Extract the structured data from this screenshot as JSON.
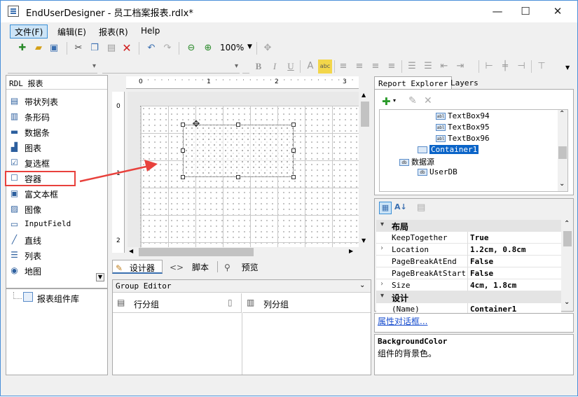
{
  "window": {
    "title": "EndUserDesigner - 员工档案报表.rdlx*",
    "minimize": "—",
    "maximize": "☐",
    "close": "✕"
  },
  "menu": {
    "items": [
      "文件(F)",
      "编辑(E)",
      "报表(R)",
      "Help"
    ]
  },
  "toolbar": {
    "zoom": "100%"
  },
  "toolbox": {
    "header": "RDL 报表",
    "items": [
      {
        "label": "带状列表",
        "icon": "banded-list-icon"
      },
      {
        "label": "条形码",
        "icon": "barcode-icon"
      },
      {
        "label": "数据条",
        "icon": "databar-icon"
      },
      {
        "label": "图表",
        "icon": "chart-icon"
      },
      {
        "label": "复选框",
        "icon": "checkbox-icon"
      },
      {
        "label": "容器",
        "icon": "container-icon"
      },
      {
        "label": "富文本框",
        "icon": "richtext-icon"
      },
      {
        "label": "图像",
        "icon": "image-icon"
      },
      {
        "label": "InputField",
        "icon": "inputfield-icon"
      },
      {
        "label": "直线",
        "icon": "line-icon"
      },
      {
        "label": "列表",
        "icon": "list-icon"
      },
      {
        "label": "地图",
        "icon": "map-icon"
      }
    ],
    "library": "报表组件库"
  },
  "ruler": {
    "marks": [
      "0",
      "1",
      "2",
      "3"
    ],
    "vmarks": [
      "0",
      "1",
      "2"
    ]
  },
  "design_tabs": {
    "designer": "设计器",
    "script": "脚本",
    "preview": "预览"
  },
  "group_editor": {
    "title": "Group Editor",
    "row_groups": "行分组",
    "column_groups": "列分组"
  },
  "right_tabs": {
    "explorer": "Report Explorer",
    "layers": "Layers"
  },
  "explorer_tree": [
    {
      "label": "TextBox94",
      "depth": 3,
      "icon": "textbox-icon",
      "tag": "abl"
    },
    {
      "label": "TextBox95",
      "depth": 3,
      "icon": "textbox-icon",
      "tag": "abl"
    },
    {
      "label": "TextBox96",
      "depth": 3,
      "icon": "textbox-icon",
      "tag": "abl"
    },
    {
      "label": "Container1",
      "depth": 2,
      "icon": "container-icon",
      "tag": "",
      "selected": true
    },
    {
      "label": "数据源",
      "depth": 1,
      "icon": "datasource-icon",
      "tag": "db"
    },
    {
      "label": "UserDB",
      "depth": 2,
      "icon": "dataset-icon",
      "tag": "db"
    }
  ],
  "properties": {
    "categories": [
      {
        "name": "布局",
        "rows": [
          {
            "name": "KeepTogether",
            "value": "True",
            "expandable": false
          },
          {
            "name": "Location",
            "value": "1.2cm, 0.8cm",
            "expandable": true
          },
          {
            "name": "PageBreakAtEnd",
            "value": "False",
            "expandable": false
          },
          {
            "name": "PageBreakAtStart",
            "value": "False",
            "expandable": false
          },
          {
            "name": "Size",
            "value": "4cm, 1.8cm",
            "expandable": true
          }
        ]
      },
      {
        "name": "设计",
        "rows": [
          {
            "name": "(Name)",
            "value": "Container1",
            "expandable": false
          }
        ]
      }
    ],
    "dialog_link": "属性对话框...",
    "desc_title": "BackgroundColor",
    "desc_text": "组件的背景色。"
  },
  "colors": {
    "highlight_box": "#e8413c",
    "selection": "#0a64c8",
    "menu_active": "#cce4f7"
  }
}
